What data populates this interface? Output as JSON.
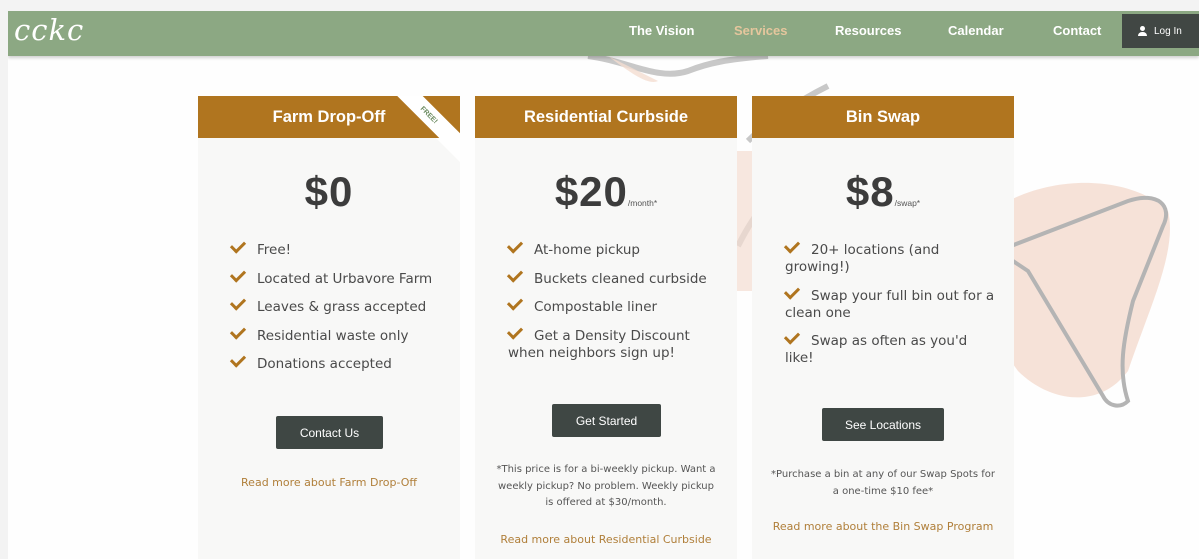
{
  "nav": {
    "logo": "cckc",
    "links": [
      "The Vision",
      "Services",
      "Resources",
      "Calendar",
      "Contact"
    ],
    "active_link": "Services",
    "login_label": "Log In"
  },
  "colors": {
    "nav_bg": "#8ca883",
    "accent": "#b0751f",
    "button": "#3f4744",
    "link": "#b07f3a",
    "active_nav": "#e5c69d"
  },
  "cards": [
    {
      "title": "Farm Drop-Off",
      "ribbon": "FREE!",
      "price": "$0",
      "unit": "",
      "features": [
        "Free!",
        "Located at Urbavore Farm",
        "Leaves & grass accepted",
        "Residential waste only",
        "Donations accepted"
      ],
      "button": "Contact Us",
      "note": "",
      "read_more": "Read more about Farm Drop-Off"
    },
    {
      "title": "Residential Curbside",
      "price": "$20",
      "unit": "/month*",
      "features": [
        "At-home pickup",
        "Buckets cleaned curbside",
        "Compostable liner",
        "Get a Density Discount when neighbors sign up!"
      ],
      "button": "Get Started",
      "note": "*This price is for a bi-weekly pickup. Want a weekly pickup? No problem. Weekly pickup is offered at $30/month.",
      "read_more": "Read more about Residential Curbside"
    },
    {
      "title": "Bin Swap",
      "price": "$8",
      "unit": "/swap*",
      "features": [
        "20+ locations (and growing!)",
        "Swap your full bin out for a clean one",
        "Swap as often as you'd like!"
      ],
      "button": "See Locations",
      "note": "*Purchase a bin at any of our Swap Spots for a one-time $10 fee*",
      "read_more": "Read more about the Bin Swap Program"
    }
  ]
}
